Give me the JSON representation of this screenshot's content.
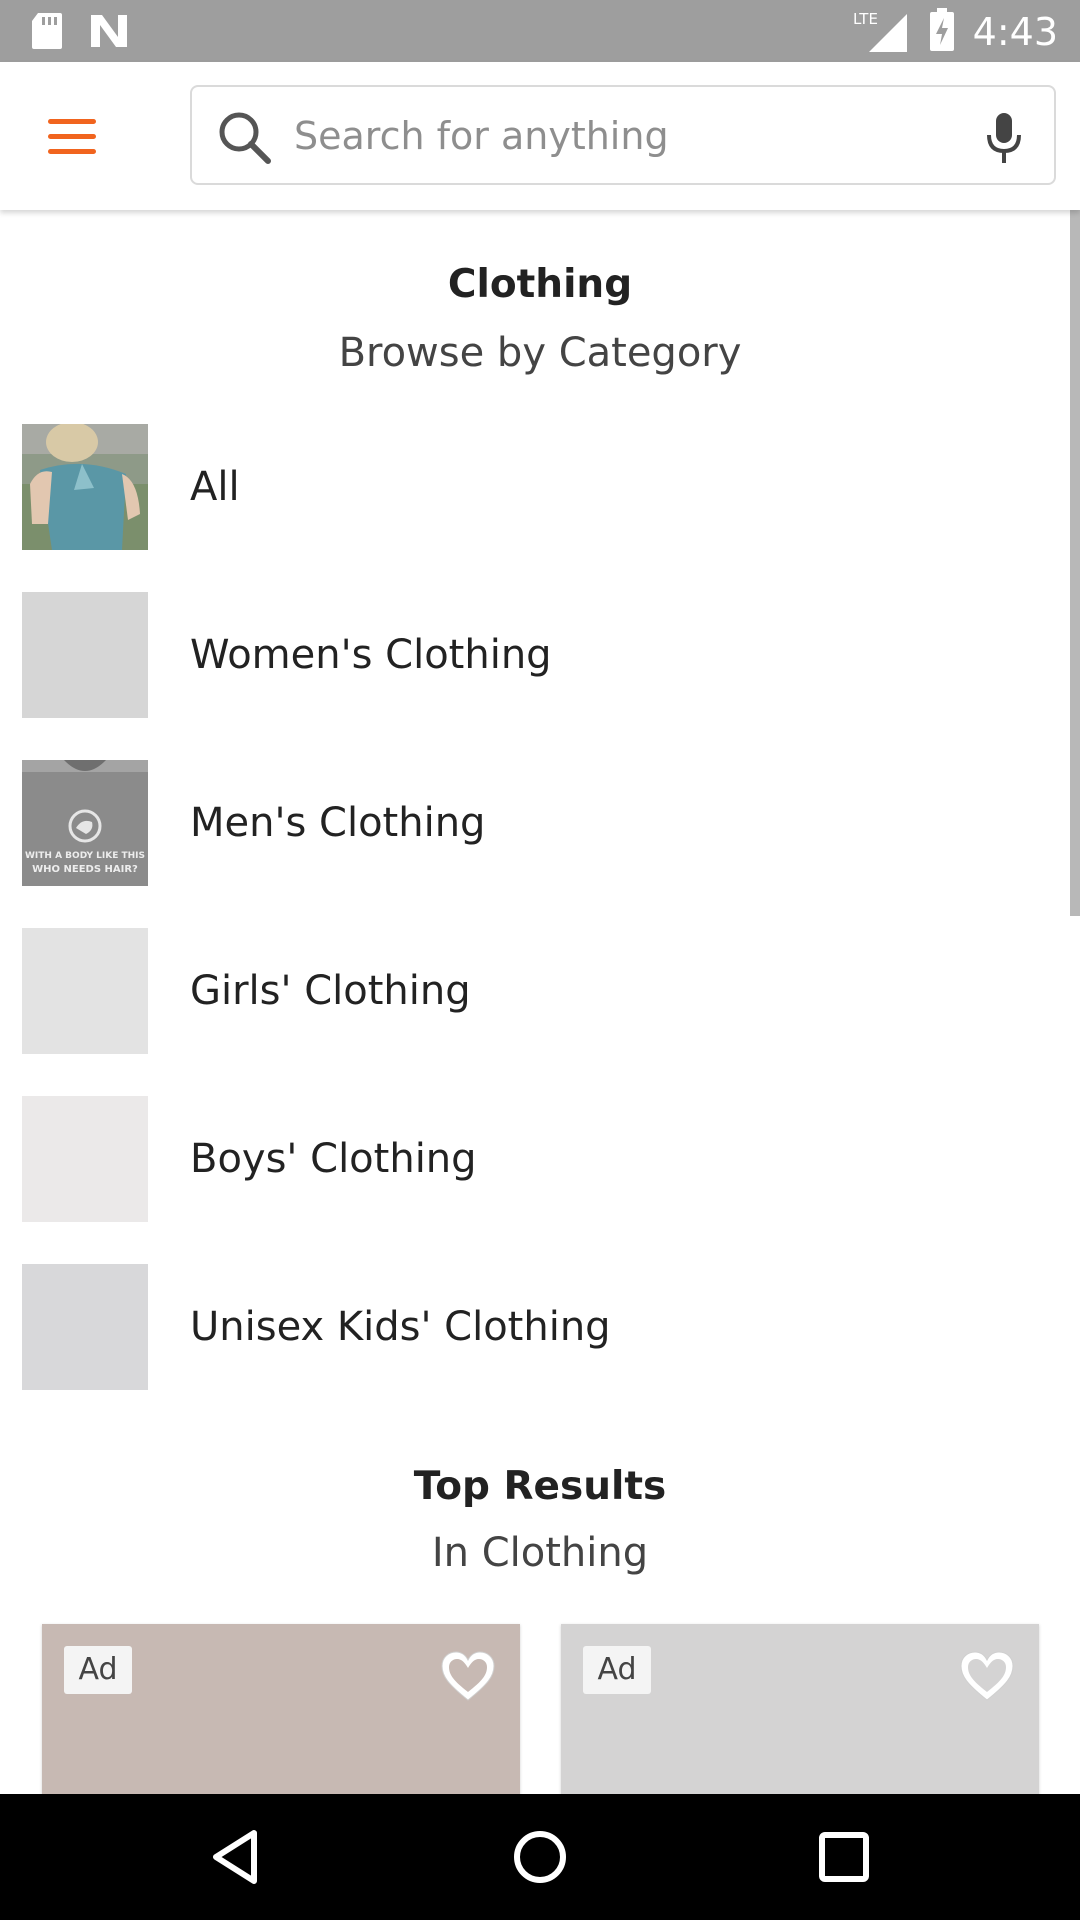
{
  "status_bar": {
    "time": "4:43",
    "network": "LTE"
  },
  "search": {
    "placeholder": "Search for anything"
  },
  "header": {
    "title": "Clothing",
    "subtitle": "Browse by Category"
  },
  "categories": [
    {
      "label": "All"
    },
    {
      "label": "Women's Clothing"
    },
    {
      "label": "Men's Clothing"
    },
    {
      "label": "Girls' Clothing"
    },
    {
      "label": "Boys' Clothing"
    },
    {
      "label": "Unisex Kids' Clothing"
    }
  ],
  "shirt_print": {
    "line1": "WITH A BODY LIKE THIS",
    "line2": "WHO NEEDS HAIR?"
  },
  "top_results": {
    "title": "Top Results",
    "subtitle": "In Clothing",
    "cards": [
      {
        "badge": "Ad",
        "color": "#c7b9b3"
      },
      {
        "badge": "Ad",
        "color": "#d4d3d3"
      }
    ]
  },
  "colors": {
    "accent": "#f1641e",
    "status_bar": "#9e9e9e"
  }
}
